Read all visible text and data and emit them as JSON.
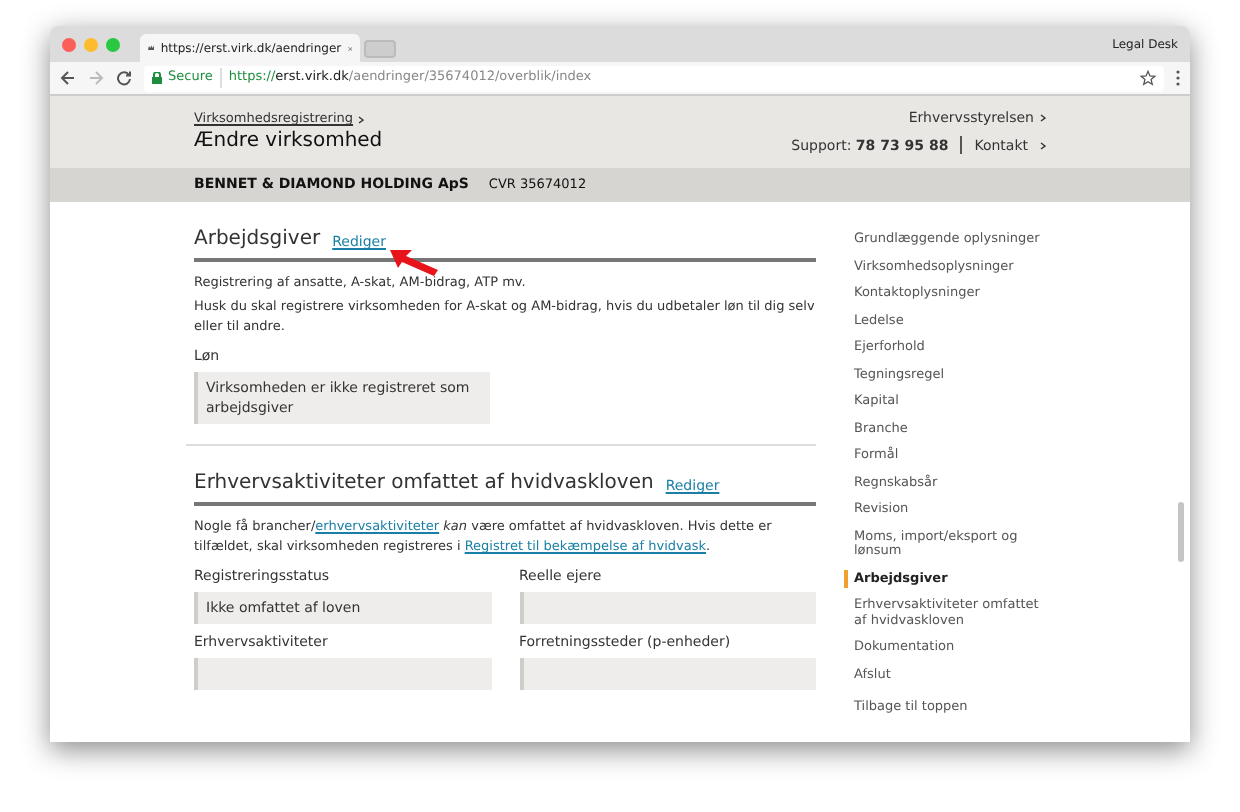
{
  "browser": {
    "tab_title": "https://erst.virk.dk/aendringer",
    "profile": "Legal Desk",
    "secure_label": "Secure",
    "url_scheme": "https://",
    "url_host": "erst.virk.dk",
    "url_path": "/aendringer/35674012/overblik/index"
  },
  "header": {
    "breadcrumb": "Virksomhedsregistrering",
    "title": "Ændre virksomhed",
    "agency_link": "Erhvervsstyrelsen",
    "support": "Support: **78 73 95 88**",
    "contact_link": "Kontakt"
  },
  "company": {
    "name": "BENNET & DIAMOND HOLDING ApS",
    "cvr": "CVR 35674012"
  },
  "sections": [
    {
      "title": "Arbejdsgiver",
      "edit_link": "Rediger",
      "pointer_arrow": true,
      "paragraphs": [
        [
          {
            "kind": "text",
            "text": "Registrering af ansatte, A-skat, AM-bidrag, ATP mv."
          }
        ],
        [
          {
            "kind": "text",
            "text": "Husk du skal registrere virksomheden for A-skat og AM-bidrag, hvis du udbetaler løn til dig selv eller til andre."
          }
        ]
      ],
      "kind": "single",
      "fields": [
        {
          "label": "Løn",
          "value": "Virksomheden er ikke registreret som arbejdsgiver"
        }
      ]
    },
    {
      "title": "Erhvervsaktiviteter omfattet af hvidvaskloven",
      "edit_link": "Rediger",
      "paragraphs": [
        [
          {
            "kind": "text",
            "text": "Nogle få brancher/"
          },
          {
            "kind": "link",
            "text": "erhvervsaktiviteter"
          },
          {
            "kind": "text",
            "text": " *kan* være omfattet af hvidvaskloven. Hvis dette er tilfældet, skal virksomheden registreres i "
          },
          {
            "kind": "link",
            "text": "Registret til bekæmpelse af hvidvask"
          },
          {
            "kind": "text",
            "text": "."
          }
        ]
      ],
      "kind": "grid",
      "fields": [
        {
          "label": "Registreringsstatus",
          "value": "Ikke omfattet af loven"
        },
        {
          "label": "Reelle ejere"
        },
        {
          "label": "Erhvervsaktiviteter"
        },
        {
          "label": "Forretningssteder (p-enheder)"
        }
      ]
    }
  ],
  "sidebar": {
    "items": [
      {
        "label": "Grundlæggende oplysninger",
        "selected": false
      },
      {
        "label": "Virksomhedsoplysninger",
        "selected": false
      },
      {
        "label": "Kontaktoplysninger",
        "selected": false
      },
      {
        "label": "Ledelse",
        "selected": false
      },
      {
        "label": "Ejerforhold",
        "selected": false
      },
      {
        "label": "Tegningsregel",
        "selected": false
      },
      {
        "label": "Kapital",
        "selected": false
      },
      {
        "label": "Branche",
        "selected": false
      },
      {
        "label": "Formål",
        "selected": false
      },
      {
        "label": "Regnskabsår",
        "selected": false
      },
      {
        "label": "Revision",
        "selected": false
      },
      {
        "label": "Moms, import/eksport og lønsum",
        "selected": false
      },
      {
        "label": "Arbejdsgiver",
        "selected": true
      },
      {
        "label": "Erhvervsaktiviteter omfattet af hvidvaskloven",
        "selected": false
      },
      {
        "label": "Dokumentation",
        "selected": false
      },
      {
        "label": "Afslut",
        "selected": false
      }
    ],
    "back_to_top": "Tilbage til toppen"
  }
}
